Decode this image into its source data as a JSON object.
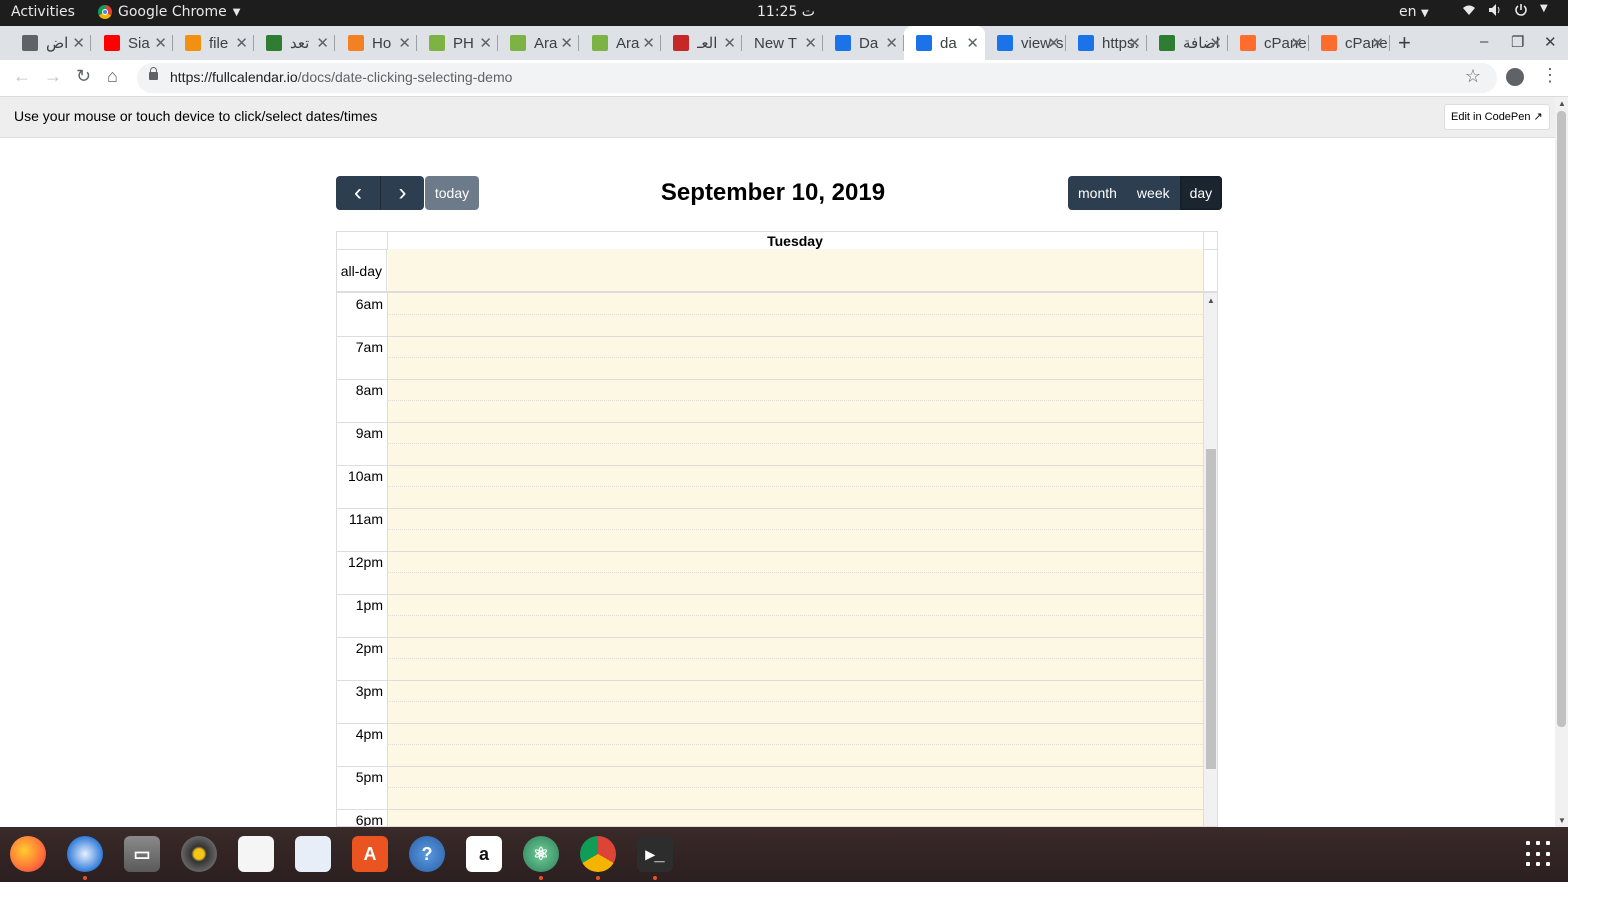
{
  "topbar": {
    "activities": "Activities",
    "app_name": "Google Chrome",
    "clock": "11:25 ت",
    "lang": "en"
  },
  "tabs": [
    {
      "title": "اض",
      "favicon": "chrome-globe-icon",
      "color": "#5f6368"
    },
    {
      "title": "Sia",
      "favicon": "youtube-icon",
      "color": "#ff0000"
    },
    {
      "title": "file",
      "favicon": "phpmyadmin-icon",
      "color": "#f29111"
    },
    {
      "title": "تعد",
      "favicon": "green-flag-icon",
      "color": "#2e7d32"
    },
    {
      "title": "Ho",
      "favicon": "stackoverflow-icon",
      "color": "#f48024"
    },
    {
      "title": "PH",
      "favicon": "green-book-icon",
      "color": "#7cb342"
    },
    {
      "title": "Ara",
      "favicon": "green-book-icon",
      "color": "#7cb342"
    },
    {
      "title": "Ara",
      "favicon": "green-book-icon",
      "color": "#7cb342"
    },
    {
      "title": "العـ",
      "favicon": "dictionary-icon",
      "color": "#c62828"
    },
    {
      "title": "New T",
      "favicon": "",
      "color": ""
    },
    {
      "title": "Da",
      "favicon": "window-icon",
      "color": "#1a73e8"
    },
    {
      "title": "da",
      "favicon": "window-icon",
      "color": "#1a73e8",
      "active": true
    },
    {
      "title": "view-s",
      "favicon": "window-icon",
      "color": "#1a73e8"
    },
    {
      "title": "https:",
      "favicon": "window-icon",
      "color": "#1a73e8"
    },
    {
      "title": "اضافة",
      "favicon": "green-flag-icon",
      "color": "#2e7d32"
    },
    {
      "title": "cPane",
      "favicon": "cpanel-icon",
      "color": "#ff6c2c"
    },
    {
      "title": "cPane",
      "favicon": "cpanel-icon",
      "color": "#ff6c2c"
    }
  ],
  "address": {
    "host": "https://fullcalendar.io",
    "path": "/docs/date-clicking-selecting-demo"
  },
  "demo_header": {
    "message": "Use your mouse or touch device to click/select dates/times",
    "codepen_button": "Edit in CodePen ↗"
  },
  "calendar": {
    "title": "September 10, 2019",
    "today_button": "today",
    "prev_icon": "‹",
    "next_icon": "›",
    "views": [
      "month",
      "week",
      "day"
    ],
    "active_view": "day",
    "day_header": "Tuesday",
    "allday_label": "all-day",
    "time_labels": [
      "6am",
      "7am",
      "8am",
      "9am",
      "10am",
      "11am",
      "12pm",
      "1pm",
      "2pm",
      "3pm",
      "4pm",
      "5pm",
      "6pm"
    ],
    "colors": {
      "button": "#2c3e50",
      "today_button": "#6c7a89",
      "today_highlight": "#fcf8e3"
    }
  },
  "dock": {
    "apps": [
      {
        "name": "firefox-icon",
        "running": false
      },
      {
        "name": "thunderbird-icon",
        "running": true
      },
      {
        "name": "files-icon",
        "running": false
      },
      {
        "name": "rhythmbox-icon",
        "running": false
      },
      {
        "name": "libreoffice-impress-icon",
        "running": false
      },
      {
        "name": "libreoffice-writer-icon",
        "running": false
      },
      {
        "name": "software-center-icon",
        "running": false
      },
      {
        "name": "help-icon",
        "running": false
      },
      {
        "name": "amazon-icon",
        "running": false
      },
      {
        "name": "atom-icon",
        "running": true
      },
      {
        "name": "chrome-icon",
        "running": true,
        "selected": true
      },
      {
        "name": "terminal-icon",
        "running": true
      }
    ]
  }
}
